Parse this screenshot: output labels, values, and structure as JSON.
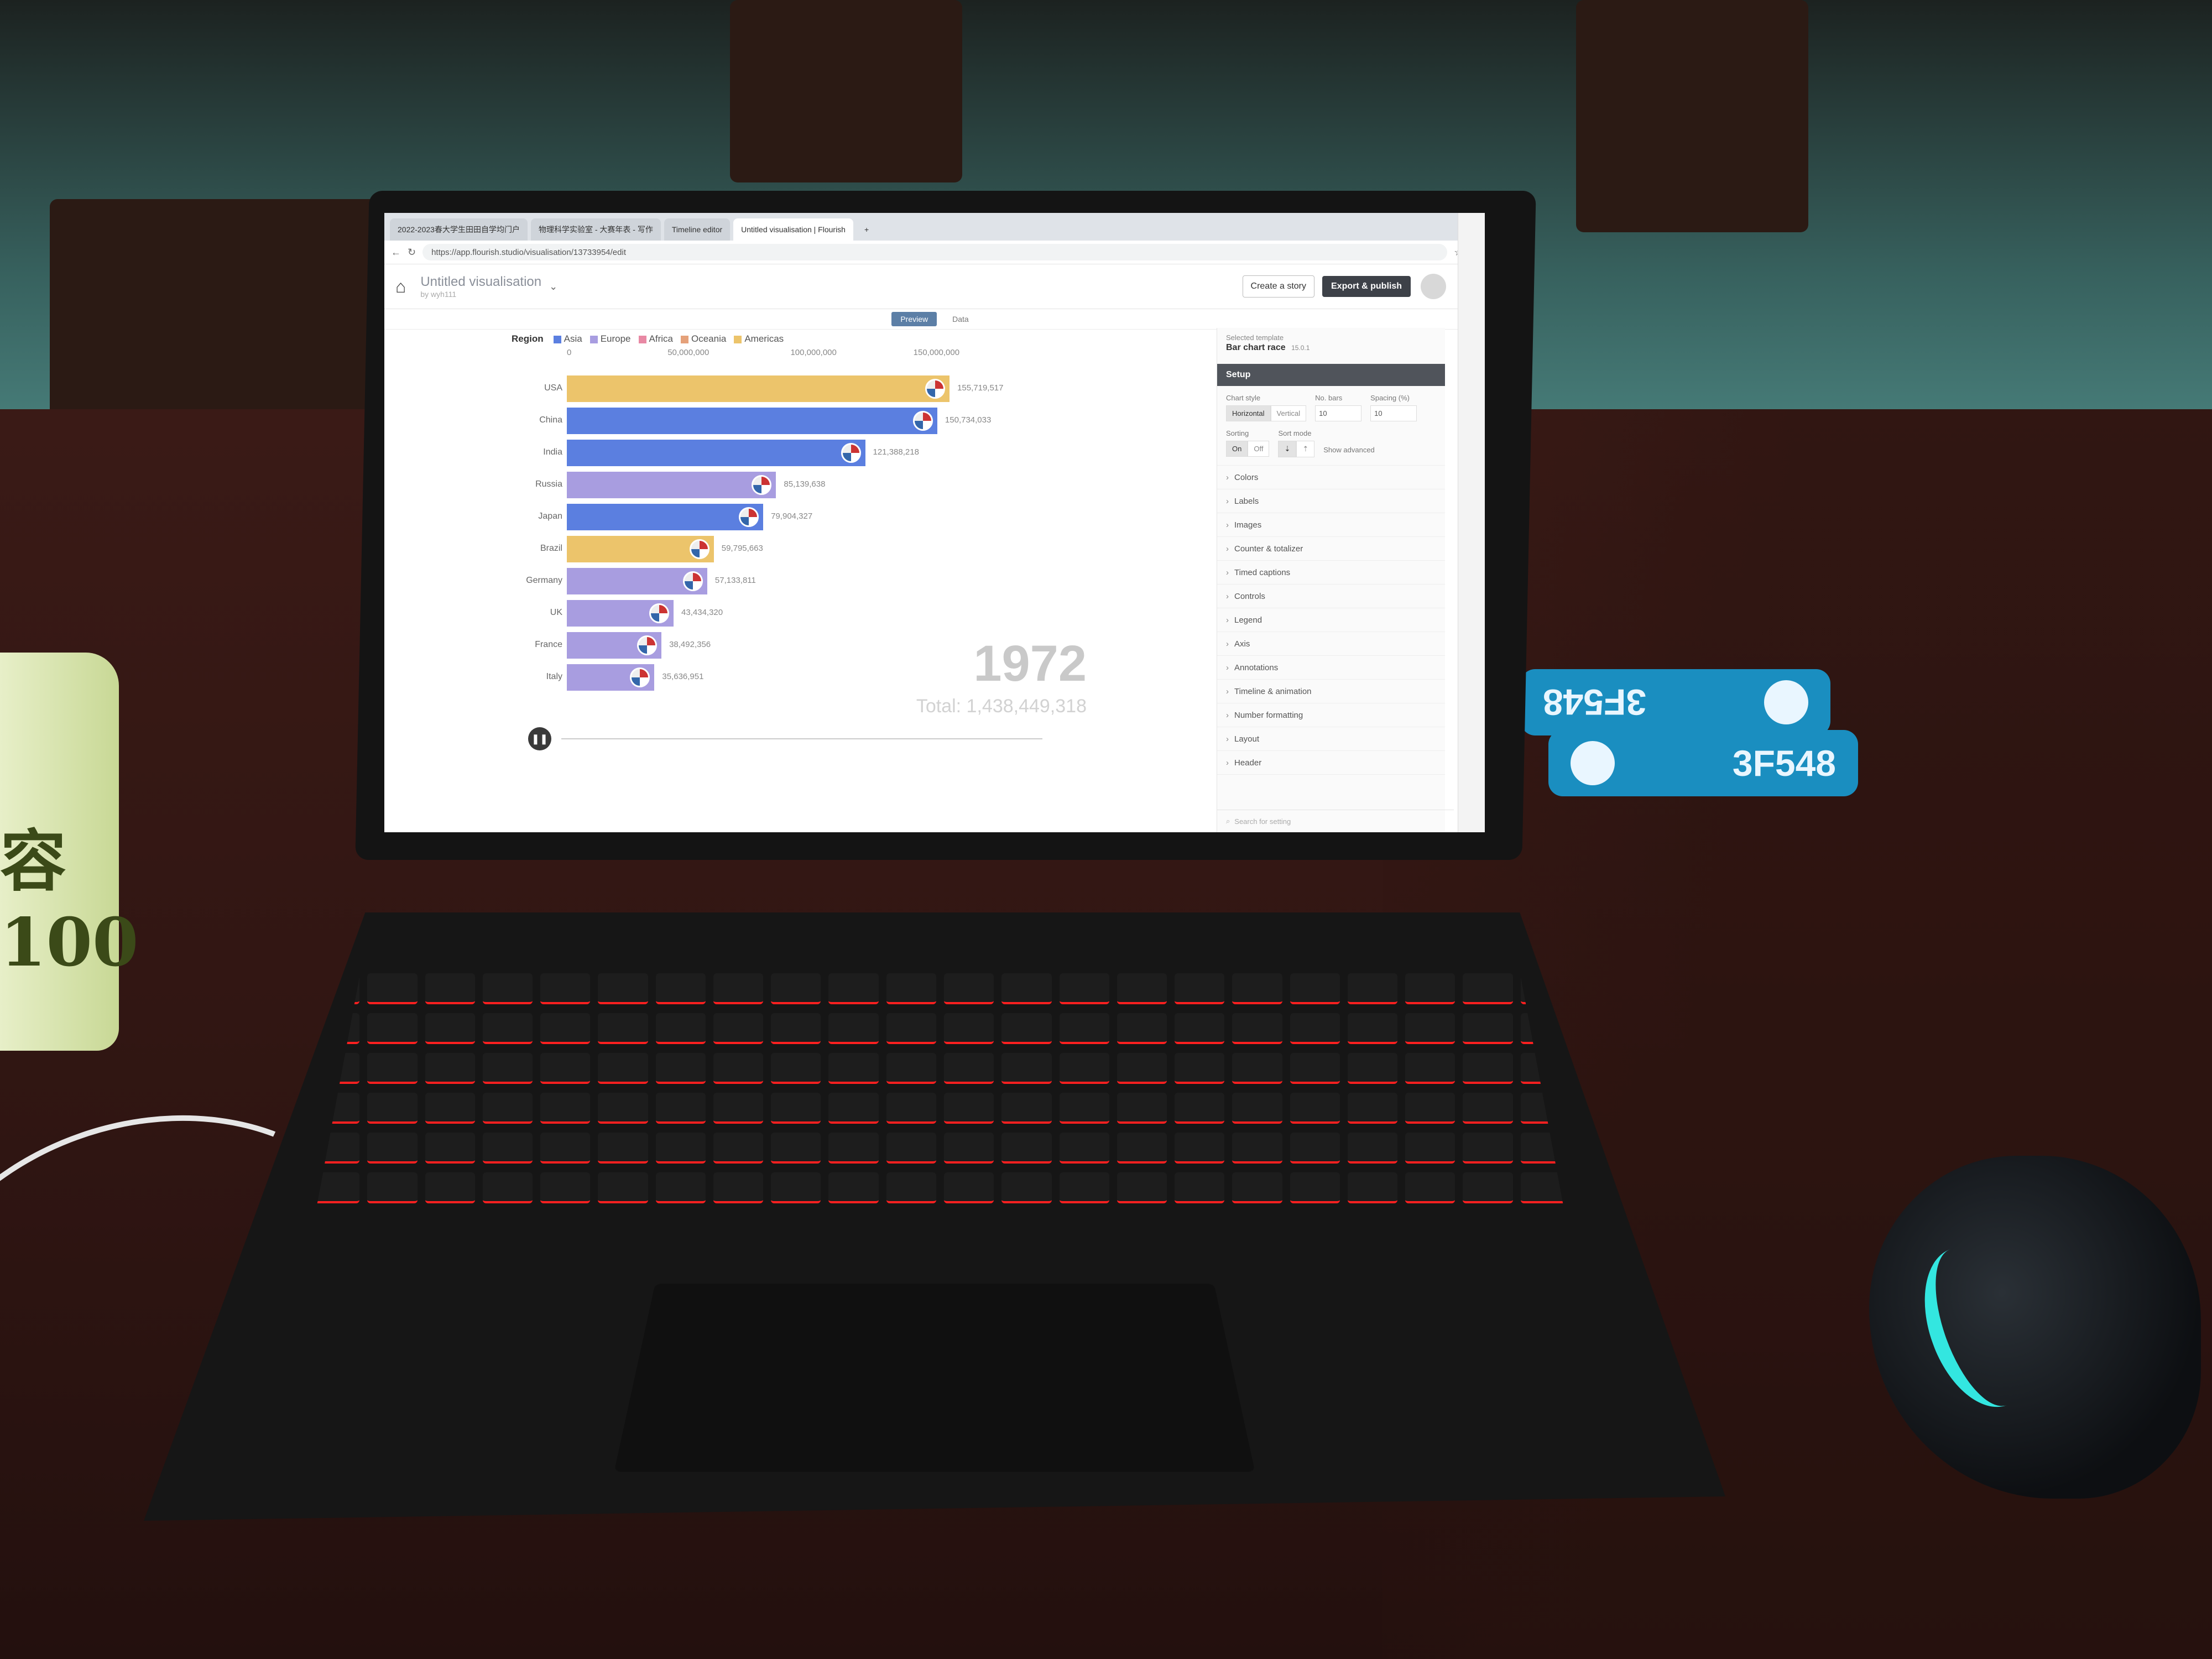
{
  "browser": {
    "tabs": [
      "2022-2023春大学生田田自学均门户",
      "物理科学实验室 - 大赛年表 - 写作",
      "Timeline editor",
      "Untitled visualisation | Flourish"
    ],
    "active_tab": 3,
    "url": "https://app.flourish.studio/visualisation/13733954/edit"
  },
  "app": {
    "title": "Untitled visualisation",
    "owner": "by wyh111",
    "create_story": "Create a story",
    "export_publish": "Export & publish",
    "view_tabs": [
      "Preview",
      "Data"
    ]
  },
  "chart_data": {
    "type": "bar",
    "year": "1972",
    "total_label": "Total: 1,438,449,318",
    "legend_title": "Region",
    "regions": [
      {
        "name": "Asia",
        "color": "#5b7fe0"
      },
      {
        "name": "Europe",
        "color": "#a89de0"
      },
      {
        "name": "Africa",
        "color": "#e889a4"
      },
      {
        "name": "Oceania",
        "color": "#e5a17a"
      },
      {
        "name": "Americas",
        "color": "#ecc46b"
      }
    ],
    "axis_ticks": [
      "0",
      "50,000,000",
      "100,000,000",
      "150,000,000"
    ],
    "xlim": [
      0,
      180000000
    ],
    "categories": [
      "USA",
      "China",
      "India",
      "Russia",
      "Japan",
      "Brazil",
      "Germany",
      "UK",
      "France",
      "Italy"
    ],
    "region_of": [
      "Americas",
      "Asia",
      "Asia",
      "Europe",
      "Asia",
      "Americas",
      "Europe",
      "Europe",
      "Europe",
      "Europe"
    ],
    "values": [
      155719517,
      150734033,
      121388218,
      85139638,
      79904327,
      59795663,
      57133811,
      43434320,
      38492356,
      35636951
    ],
    "value_labels": [
      "155,719,517",
      "150,734,033",
      "121,388,218",
      "85,139,638",
      "79,904,327",
      "59,795,663",
      "57,133,811",
      "43,434,320",
      "38,492,356",
      "35,636,951"
    ]
  },
  "panel": {
    "template_label": "Selected template",
    "template_name": "Bar chart race",
    "template_version": "15.0.1",
    "setup": "Setup",
    "chart_style_label": "Chart style",
    "chart_style_options": [
      "Horizontal",
      "Vertical"
    ],
    "no_bars_label": "No. bars",
    "no_bars_value": "10",
    "spacing_label": "Spacing (%)",
    "spacing_value": "10",
    "sorting_label": "Sorting",
    "sorting_options": [
      "On",
      "Off"
    ],
    "sort_mode_label": "Sort mode",
    "show_advanced": "Show advanced",
    "sections": [
      "Colors",
      "Labels",
      "Images",
      "Counter & totalizer",
      "Timed captions",
      "Controls",
      "Legend",
      "Axis",
      "Annotations",
      "Timeline & animation",
      "Number formatting",
      "Layout",
      "Header"
    ],
    "search_placeholder": "Search for setting"
  },
  "scene": {
    "seat_number": "3F548",
    "bottle_text": "容100"
  }
}
